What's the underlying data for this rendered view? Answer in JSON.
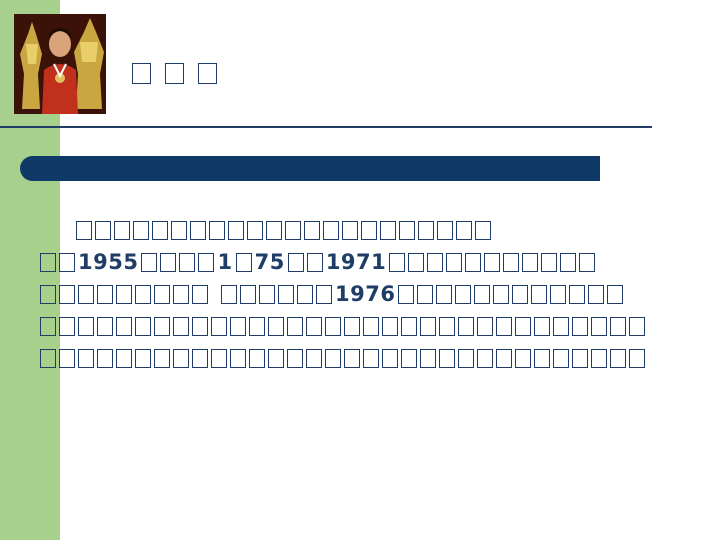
{
  "slide": {
    "colors": {
      "side_bar": "#a8d08d",
      "banner": "#0f3966",
      "text": "#1f3d66"
    },
    "photo": {
      "icon": "player-with-trophies-photo"
    },
    "title_glyph_count": 3,
    "body_lines": [
      {
        "indent": true,
        "segments": [
          {
            "boxes": 22
          }
        ]
      },
      {
        "indent": false,
        "segments": [
          {
            "boxes": 2
          },
          {
            "text": "1955"
          },
          {
            "boxes": 4
          },
          {
            "text": "1"
          },
          {
            "boxes": 1
          },
          {
            "text": "75"
          },
          {
            "boxes": 2
          },
          {
            "text": "1971"
          },
          {
            "boxes": 11
          }
        ]
      },
      {
        "indent": false,
        "segments": [
          {
            "boxes": 9
          },
          {
            "gap": true
          },
          {
            "boxes": 6
          },
          {
            "text": "1976"
          },
          {
            "boxes": 12
          }
        ]
      },
      {
        "indent": false,
        "segments": [
          {
            "boxes": 32
          }
        ]
      },
      {
        "indent": false,
        "segments": [
          {
            "boxes": 32
          }
        ]
      }
    ]
  }
}
